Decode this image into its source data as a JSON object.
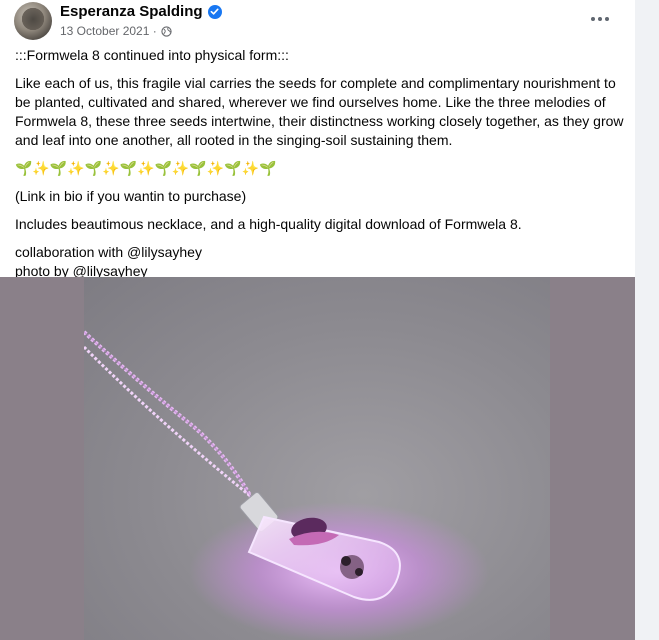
{
  "post": {
    "author": "Esperanza Spalding",
    "date": "13 October 2021 ·",
    "paragraphs": [
      ":::Formwela 8 continued into physical form:::",
      "Like each of us, this fragile vial carries the seeds for complete and complimentary nourishment to be planted, cultivated and shared, wherever we find ourselves home. Like the three melodies of Formwela 8, these three seeds intertwine, their distinctness working closely together, as they grow and leaf into one another, all rooted in the singing-soil sustaining them.",
      "🌱✨🌱✨🌱✨🌱✨🌱✨🌱✨🌱✨🌱",
      "(Link in bio if you wantin to purchase)",
      "Includes beautimous necklace, and a high-quality digital download of Formwela 8."
    ],
    "credits": [
      "collaboration with @lilysayhey",
      "photo by @lilysayhey"
    ]
  },
  "icons": {
    "verified": "verified-badge-icon",
    "audience": "globe-icon",
    "more": "more-options-icon"
  },
  "colors": {
    "brand_blue": "#1877f2",
    "text_primary": "#050505",
    "text_secondary": "#65676b",
    "vial_glow": "#d78cf0"
  }
}
